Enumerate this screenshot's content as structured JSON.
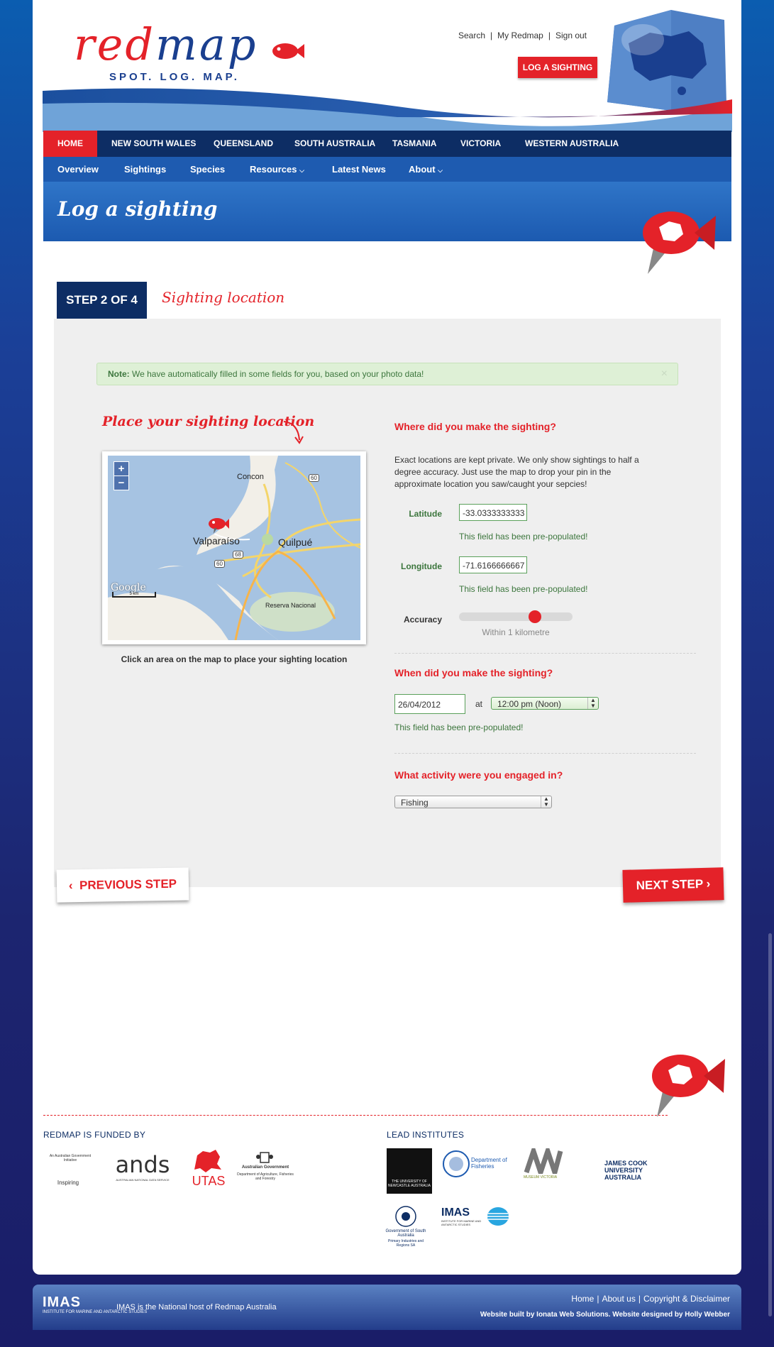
{
  "header": {
    "logo_red": "redmap",
    "logo_tagline": "SPOT. LOG. MAP.",
    "top_links": [
      "Search",
      "My Redmap",
      "Sign out"
    ],
    "log_button": "LOG A SIGHTING"
  },
  "nav_states": [
    "HOME",
    "NEW SOUTH WALES",
    "QUEENSLAND",
    "SOUTH AUSTRALIA",
    "TASMANIA",
    "VICTORIA",
    "WESTERN AUSTRALIA"
  ],
  "nav_sub": [
    "Overview",
    "Sightings",
    "Species",
    "Resources",
    "Latest News",
    "About"
  ],
  "banner_title": "Log a sighting",
  "step": {
    "tab": "STEP 2 OF 4",
    "label": "Sighting location"
  },
  "note": {
    "prefix": "Note:",
    "text": "We have automatically filled in some fields for you, based on your photo data!",
    "close": "×"
  },
  "map": {
    "hand_label": "Place your sighting location",
    "caption": "Click an area on the map to place your sighting location",
    "zoom_in": "+",
    "zoom_out": "−",
    "places": [
      "Concon",
      "Valparaíso",
      "Quilpué",
      "Reserva Nacional"
    ],
    "road_shields": [
      "60",
      "60",
      "68"
    ],
    "attribution": "Google",
    "scale": "5 km"
  },
  "location": {
    "heading": "Where did you make the sighting?",
    "description": "Exact locations are kept private. We only show sightings to half a degree accuracy. Just use the map to drop your pin in the approximate location you saw/caught your sepcies!",
    "latitude_label": "Latitude",
    "latitude_value": "-33.0333333333",
    "latitude_help": "This field has been pre-populated!",
    "longitude_label": "Longitude",
    "longitude_value": "-71.6166666667",
    "longitude_help": "This field has been pre-populated!",
    "accuracy_label": "Accuracy",
    "accuracy_text": "Within 1 kilometre",
    "accuracy_level": 0.67
  },
  "when": {
    "heading": "When did you make the sighting?",
    "date": "26/04/2012",
    "at": "at",
    "time": "12:00 pm (Noon)",
    "help": "This field has been pre-populated!"
  },
  "activity": {
    "heading": "What activity were you engaged in?",
    "value": "Fishing"
  },
  "buttons": {
    "prev": "PREVIOUS STEP",
    "next": "NEXT STEP"
  },
  "funded": {
    "heading": "REDMAP IS FUNDED BY",
    "logos": [
      "An Australian Government Initiative",
      "Inspiring",
      "ands",
      "AUSTRALIAN NATIONAL DATA SERVICE",
      "UTAS",
      "Australian Government",
      "Department of Agriculture, Fisheries and Forestry"
    ]
  },
  "lead": {
    "heading": "LEAD INSTITUTES",
    "logos": [
      "THE UNIVERSITY OF NEWCASTLE AUSTRALIA",
      "Department of Fisheries",
      "MUSEUM VICTORIA",
      "JAMES COOK UNIVERSITY AUSTRALIA",
      "IMAS",
      "INSTITUTE FOR MARINE AND ANTARCTIC STUDIES",
      "Government of South Australia",
      "Primary Industries and Regions SA"
    ]
  },
  "footer": {
    "imas": "IMAS",
    "imas_sub": "INSTITUTE FOR MARINE AND ANTARCTIC STUDIES",
    "host": "IMAS is the National host of Redmap Australia",
    "links": [
      "Home",
      "About us",
      "Copyright & Disclaimer"
    ],
    "credit": "Website built by Ionata Web Solutions. Website designed by Holly Webber"
  },
  "colors": {
    "brand_red": "#e42229",
    "navy": "#0d2d64",
    "nav_blue": "#1e5bb0",
    "success_green": "#3c763d"
  }
}
